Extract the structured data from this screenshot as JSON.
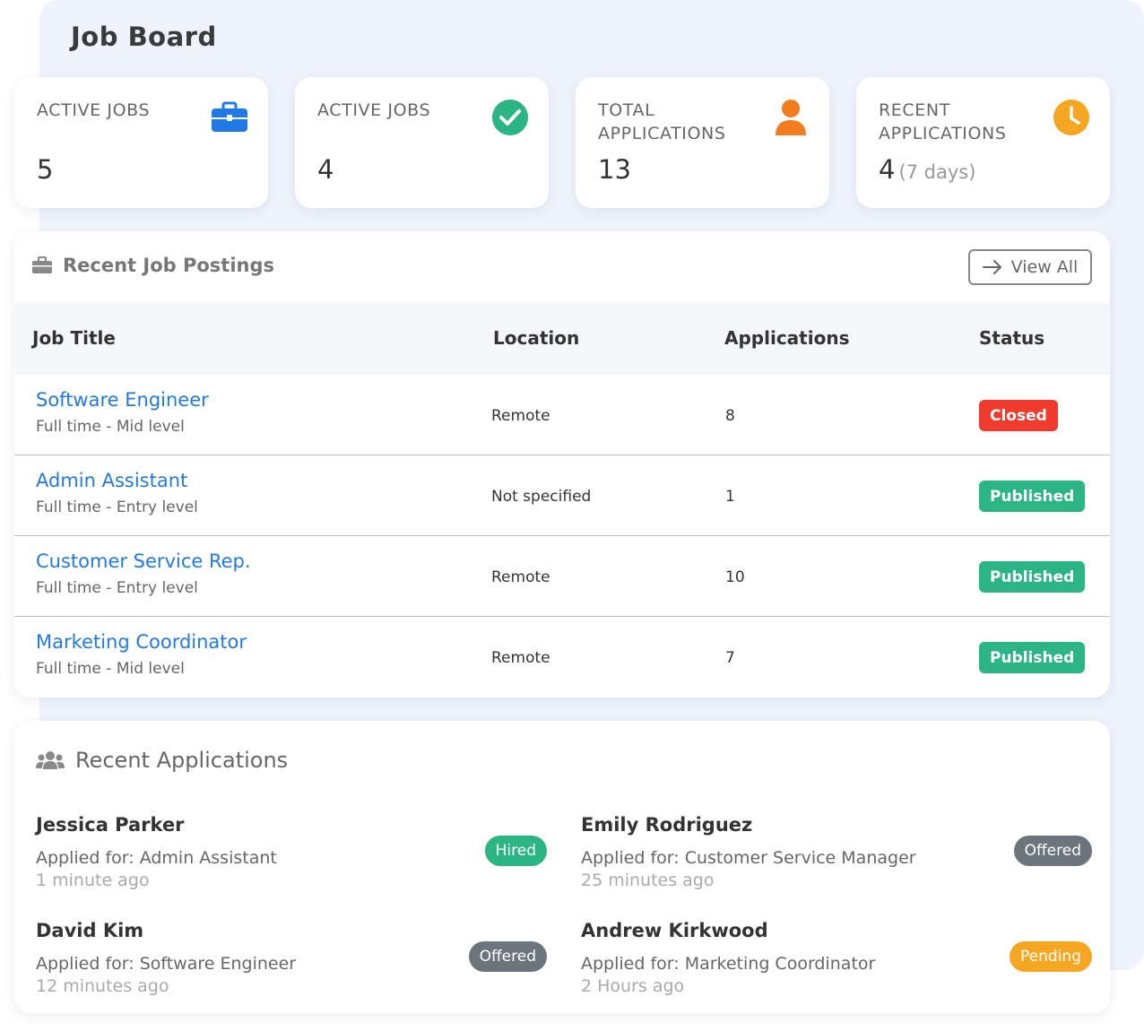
{
  "page": {
    "title": "Job Board"
  },
  "stats": [
    {
      "label": "ACTIVE JOBS",
      "value": "5",
      "icon": "briefcase-icon",
      "color": "#1f7ae8"
    },
    {
      "label": "ACTIVE JOBS",
      "value": "4",
      "icon": "check-circle-icon",
      "color": "#2bb585"
    },
    {
      "label": "TOTAL APPLICATIONS",
      "value": "13",
      "icon": "user-icon",
      "color": "#f47c20"
    },
    {
      "label": "RECENT APPLICATIONS",
      "value": "4",
      "sub": "(7 days)",
      "icon": "clock-icon",
      "color": "#f5a623"
    }
  ],
  "postings": {
    "title": "Recent Job Postings",
    "view_all": "View All",
    "columns": [
      "Job Title",
      "Location",
      "Applications",
      "Status"
    ],
    "rows": [
      {
        "title": "Software Engineer",
        "meta": "Full time - Mid level",
        "location": "Remote",
        "applications": "8",
        "status": "Closed",
        "status_color": "#f03a2e"
      },
      {
        "title": "Admin Assistant",
        "meta": "Full time - Entry level",
        "location": "Not specified",
        "applications": "1",
        "status": "Published",
        "status_color": "#2bb585"
      },
      {
        "title": "Customer Service Rep.",
        "meta": "Full time - Entry level",
        "location": "Remote",
        "applications": "10",
        "status": "Published",
        "status_color": "#2bb585"
      },
      {
        "title": "Marketing Coordinator",
        "meta": "Full time - Mid level",
        "location": "Remote",
        "applications": "7",
        "status": "Published",
        "status_color": "#2bb585"
      }
    ]
  },
  "applications": {
    "title": "Recent Applications",
    "items": [
      {
        "name": "Jessica Parker",
        "applied_for": "Applied for: Admin Assistant",
        "time": "1 minute ago",
        "status": "Hired",
        "status_color": "#2bb585"
      },
      {
        "name": "Emily Rodriguez",
        "applied_for": "Applied for: Customer Service Manager",
        "time": "25 minutes ago",
        "status": "Offered",
        "status_color": "#6c757d"
      },
      {
        "name": "David Kim",
        "applied_for": "Applied for: Software Engineer",
        "time": "12 minutes ago",
        "status": "Offered",
        "status_color": "#6c757d"
      },
      {
        "name": "Andrew Kirkwood",
        "applied_for": "Applied for: Marketing Coordinator",
        "time": "2 Hours ago",
        "status": "Pending",
        "status_color": "#f5a623"
      }
    ]
  }
}
